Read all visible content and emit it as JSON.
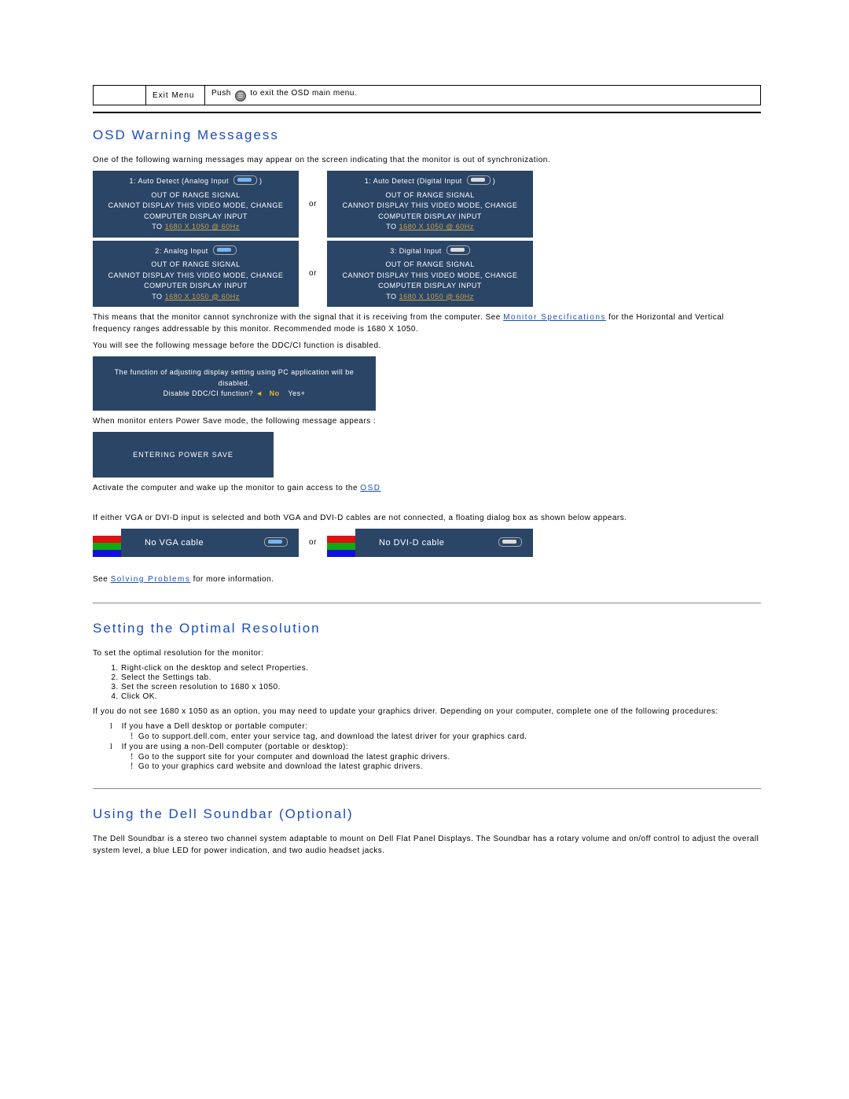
{
  "exit_menu": {
    "label": "Exit Menu",
    "instruction_before": "Push ",
    "instruction_after": " to exit the OSD main menu."
  },
  "sec1": {
    "title": "OSD Warning Messagess",
    "intro": "One of the following warning messages may appear on the screen indicating that the monitor is out of synchronization.",
    "or": "or",
    "cards": {
      "c1_title": "1: Auto Detect (Analog Input",
      "c2_title": "1: Auto Detect (Digital Input",
      "c3_title": "2: Analog Input",
      "c4_title": "3: Digital Input",
      "out_of_range": "OUT OF RANGE SIGNAL",
      "cannot_l1": "CANNOT DISPLAY THIS VIDEO MODE, CHANGE",
      "cannot_l2": "COMPUTER DISPLAY INPUT",
      "res_prefix": "TO ",
      "res_link": "1680 X 1050 @ 60Hz"
    },
    "sync_text_before": "This means that the monitor cannot synchronize with the signal that it is receiving from the computer. See ",
    "sync_link": "Monitor Specifications",
    "sync_text_after": " for the Horizontal and Vertical frequency ranges addressable by this monitor. Recommended mode is 1680 X 1050.",
    "ddc_intro": "You will see the following message before the DDC/CI function is disabled.",
    "ddc_line1": "The function of adjusting display setting using PC application will be disabled.",
    "ddc_line2a": "Disable DDC/CI function?",
    "ddc_no": "No",
    "ddc_yes": "Yes+",
    "ps_intro": "When monitor enters Power Save mode, the following message appears :",
    "ps_text": "ENTERING POWER SAVE",
    "ps_after_before": "Activate the computer and wake up the monitor to gain access to the ",
    "ps_after_link": "OSD",
    "cable_intro": "If either VGA or DVI-D input is selected and both VGA and DVI-D cables are not connected, a floating dialog box as shown below appears.",
    "nc_vga": "No VGA cable",
    "nc_dvi": "No DVI-D cable",
    "see_before": "See ",
    "see_link": "Solving Problems",
    "see_after": " for more information."
  },
  "sec2": {
    "title": "Setting the Optimal Resolution",
    "intro": "To set the optimal resolution for the monitor:",
    "steps": [
      "Right-click on the desktop and select Properties.",
      "Select the Settings tab.",
      "Set the screen resolution to 1680 x 1050.",
      "Click OK."
    ],
    "note": "If you do not see 1680 x 1050 as an option, you may need to update your graphics driver. Depending on your computer, complete one of the following procedures:",
    "l1": "If you have a Dell desktop or portable computer:",
    "l1o1": "Go to support.dell.com, enter your service tag, and download the latest driver for your graphics card.",
    "l2": "If you are using a non-Dell computer (portable or desktop):",
    "l2o1": "Go to the support site for your computer and download the latest graphic drivers.",
    "l2o2": "Go to your graphics card website and download the latest graphic drivers."
  },
  "sec3": {
    "title": "Using the Dell Soundbar (Optional)",
    "text": "The Dell Soundbar is a stereo two channel system adaptable to mount on Dell Flat Panel Displays. The Soundbar has a rotary volume and on/off control to adjust the overall system level, a blue LED for power indication, and two audio headset jacks."
  }
}
